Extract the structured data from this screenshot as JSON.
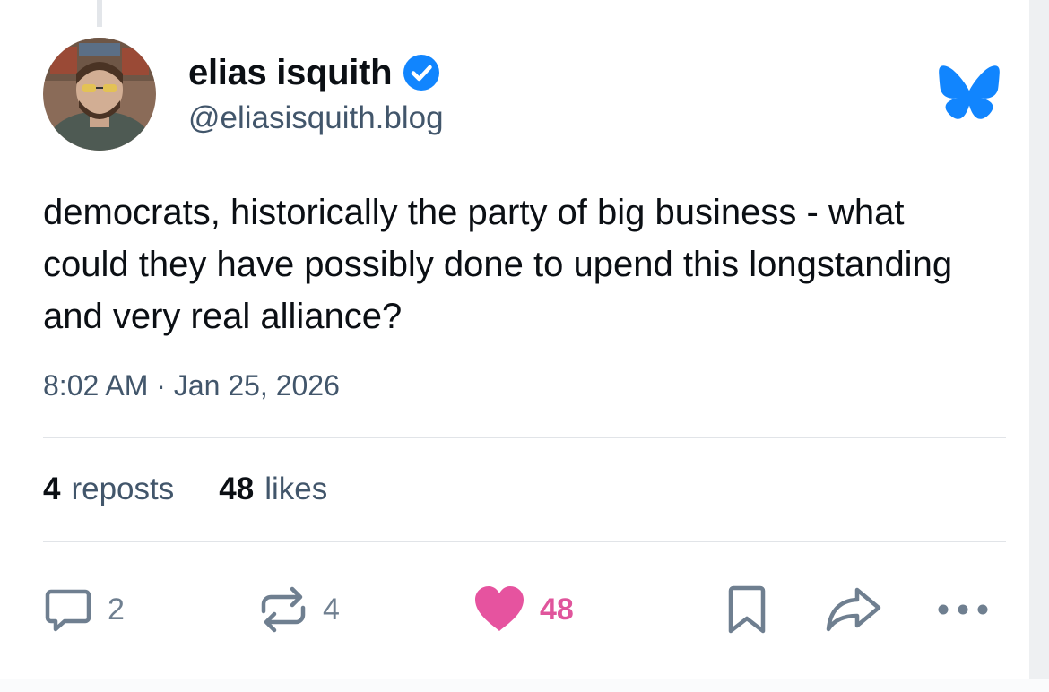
{
  "post": {
    "author": {
      "display_name": "elias isquith",
      "handle": "@eliasisquith.blog",
      "avatar": "avatar-photo",
      "verified_icon": "verified-check-icon"
    },
    "platform_icon": "bluesky-butterfly-icon",
    "text": "democrats, historically the party of big business - what could they have possibly done to upend this longstanding and very real alliance?",
    "timestamp": "8:02 AM · Jan 25, 2026",
    "stats": {
      "reposts_count": "4",
      "reposts_label": "reposts",
      "likes_count": "48",
      "likes_label": "likes"
    },
    "actions": {
      "reply_count": "2",
      "repost_count": "4",
      "like_count": "48",
      "reply_icon": "reply-bubble-icon",
      "repost_icon": "repost-icon",
      "like_icon": "heart-icon",
      "bookmark_icon": "bookmark-icon",
      "share_icon": "share-icon",
      "more_icon": "more-dots-icon"
    }
  },
  "colors": {
    "bluesky_blue": "#1185fe",
    "like_pink": "#ec4899",
    "muted_text": "#42566b",
    "icon_gray": "#6f7f90"
  }
}
